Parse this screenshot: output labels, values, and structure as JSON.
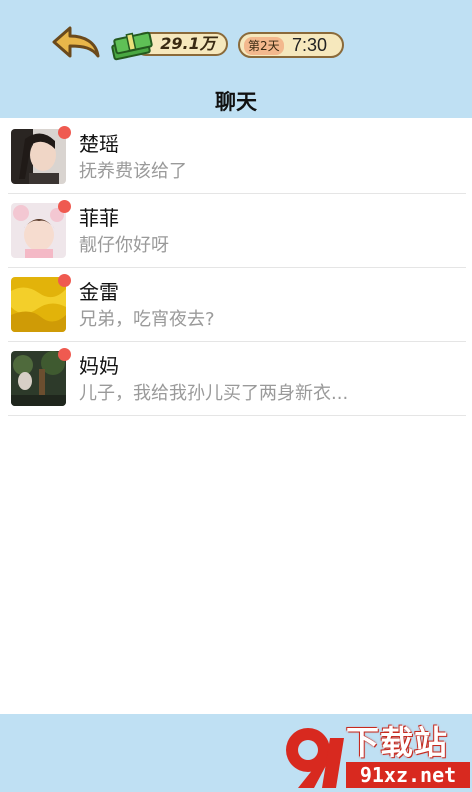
{
  "header": {
    "money": "29.1万",
    "day": "第2天",
    "time": "7:30",
    "title": "聊天"
  },
  "chats": [
    {
      "name": "楚瑶",
      "preview": "抚养费该给了",
      "unread": true,
      "avatar": "woman-portrait"
    },
    {
      "name": "菲菲",
      "preview": "靓仔你好呀",
      "unread": true,
      "avatar": "girl-portrait"
    },
    {
      "name": "金雷",
      "preview": "兄弟，吃宵夜去?",
      "unread": true,
      "avatar": "gold-texture"
    },
    {
      "name": "妈妈",
      "preview": "儿子，我给我孙儿买了两身新衣...",
      "unread": true,
      "avatar": "garden-photo"
    }
  ],
  "watermark": {
    "logo_text": "9",
    "title": "下载站",
    "url": "91xz.net"
  },
  "colors": {
    "topbar": "#bfe0f3",
    "unread_dot": "#ef5a50",
    "pill_bg": "#f6e8bd",
    "watermark_red": "#d8291f"
  }
}
